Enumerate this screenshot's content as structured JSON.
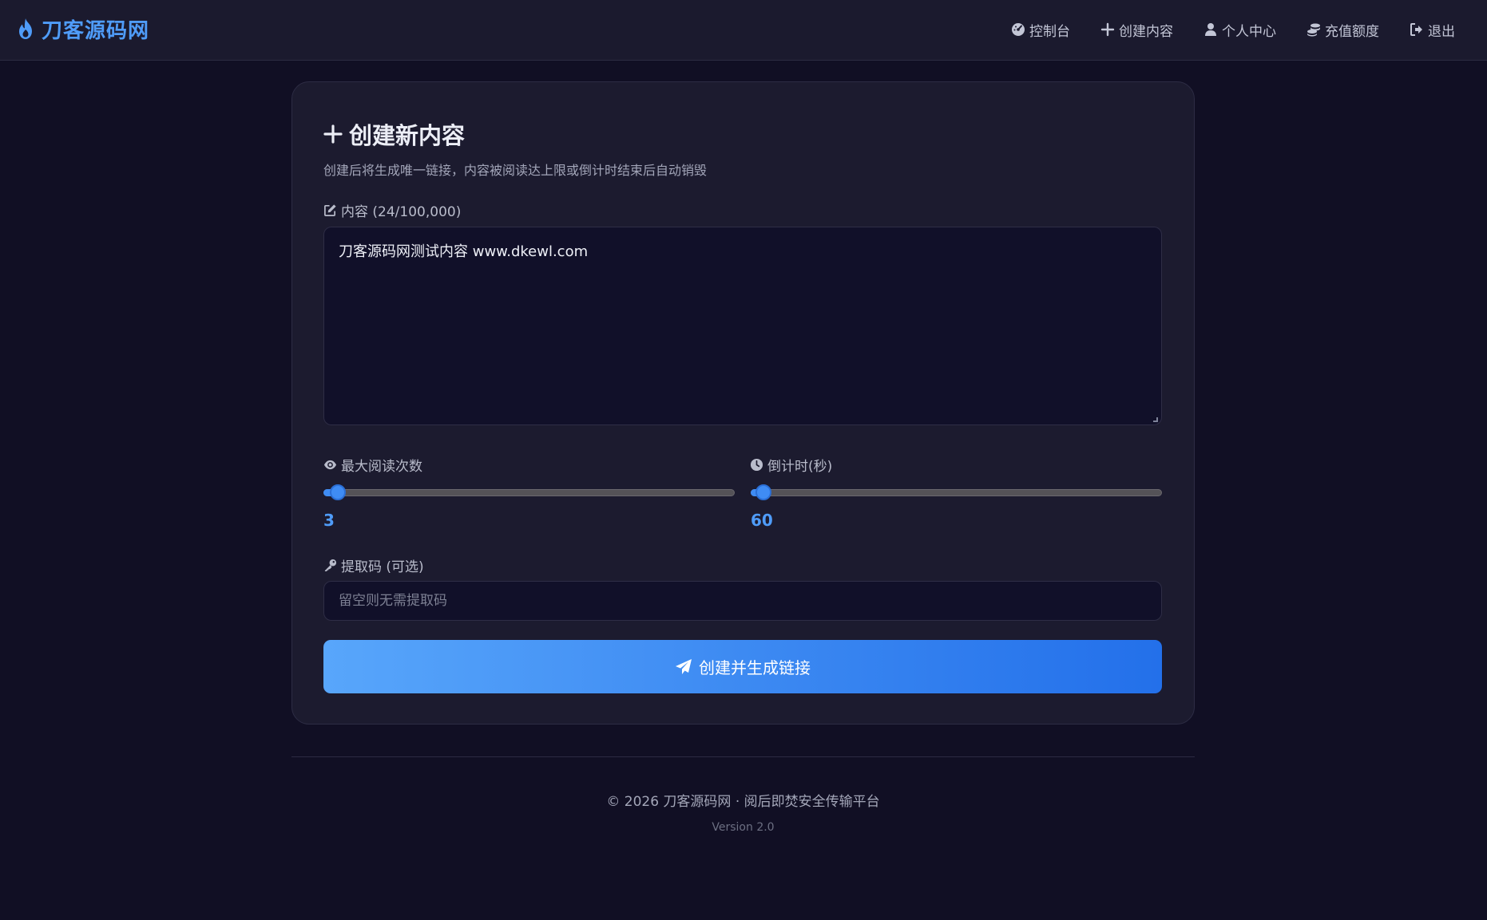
{
  "app": {
    "brand": "刀客源码网",
    "brand_icon": "flame-icon",
    "accent_color": "#4f9cf9"
  },
  "nav": {
    "items": [
      {
        "label": "控制台",
        "icon": "dashboard-icon"
      },
      {
        "label": "创建内容",
        "icon": "plus-icon"
      },
      {
        "label": "个人中心",
        "icon": "user-icon"
      },
      {
        "label": "充值额度",
        "icon": "coins-icon"
      },
      {
        "label": "退出",
        "icon": "logout-icon"
      }
    ]
  },
  "form": {
    "title": "创建新内容",
    "subtitle": "创建后将生成唯一链接，内容被阅读达上限或倒计时结束后自动销毁",
    "content_label": "内容 (24/100,000)",
    "content_value": "刀客源码网测试内容  www.dkewl.com",
    "max_reads_label": "最大阅读次数",
    "max_reads_value": "3",
    "countdown_label": "倒计时(秒)",
    "countdown_value": "60",
    "code_label": "提取码 (可选)",
    "code_placeholder": "留空则无需提取码",
    "submit_label": "创建并生成链接"
  },
  "footer": {
    "copyright": "© 2026 刀客源码网 · 阅后即焚安全传输平台",
    "version": "Version 2.0"
  }
}
